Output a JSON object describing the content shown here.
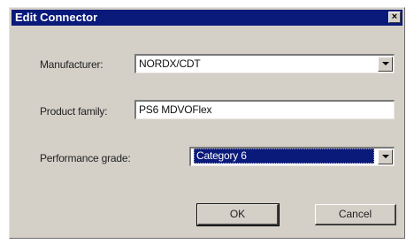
{
  "dialog": {
    "title": "Edit Connector",
    "close_glyph": "×"
  },
  "form": {
    "manufacturer": {
      "label": "Manufacturer:",
      "value": "NORDX/CDT"
    },
    "product_family": {
      "label": "Product family:",
      "value": "PS6 MDVOFlex"
    },
    "performance_grade": {
      "label": "Performance grade:",
      "value": "Category 6"
    }
  },
  "buttons": {
    "ok": "OK",
    "cancel": "Cancel"
  },
  "icons": {
    "dropdown": "chevron-down-icon",
    "close": "close-icon"
  },
  "colors": {
    "titlebar": "#0a1a7a",
    "dialog_bg": "#d4d0c8",
    "selection": "#0a1a7a"
  }
}
